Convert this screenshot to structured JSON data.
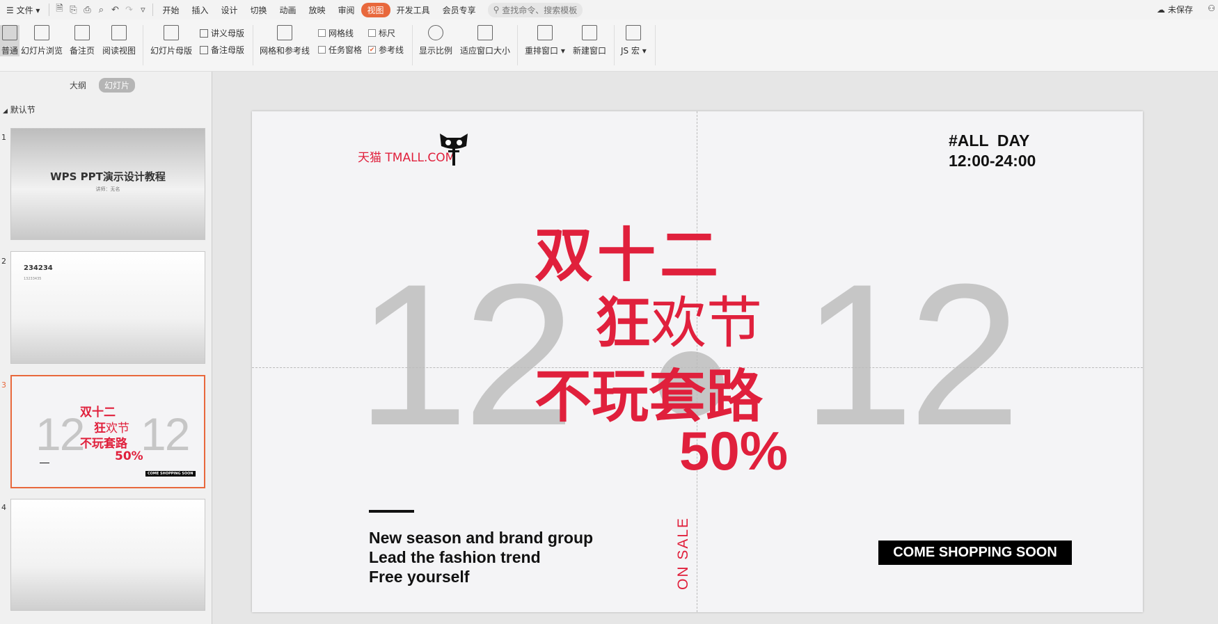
{
  "menu": {
    "file": "文件",
    "tabs": [
      "开始",
      "插入",
      "设计",
      "切换",
      "动画",
      "放映",
      "审阅",
      "视图",
      "开发工具",
      "会员专享"
    ],
    "active_tab": "视图",
    "search_placeholder": "查找命令、搜索模板",
    "save_status": "未保存"
  },
  "ribbon": {
    "normal": "普通",
    "slide_sorter": "幻灯片浏览",
    "notes_page": "备注页",
    "reading_view": "阅读视图",
    "slide_master": "幻灯片母版",
    "handout_master": "讲义母版",
    "notes_master": "备注母版",
    "grid_guides": "网格和参考线",
    "gridlines": "网格线",
    "ruler": "标尺",
    "task_pane": "任务窗格",
    "guides": "参考线",
    "zoom": "显示比例",
    "fit_window": "适应窗口大小",
    "rearrange": "重排窗口",
    "new_window": "新建窗口",
    "js_macro": "JS 宏"
  },
  "panel": {
    "tab_outline": "大纲",
    "tab_slides": "幻灯片",
    "section": "默认节",
    "thumbs": [
      {
        "num": "1",
        "title": "WPS PPT演示设计教程",
        "sub": "讲师：无名"
      },
      {
        "num": "2",
        "title": "234234",
        "sub": "13233435"
      },
      {
        "num": "3"
      },
      {
        "num": "4"
      }
    ]
  },
  "slide": {
    "logo": "天猫 TMALL.COM",
    "allday": "#ALL  DAY\n12:00-24:00",
    "big_left": "12",
    "big_right": "12",
    "line1": "双十二",
    "line2a": "狂",
    "line2b": "欢节",
    "line3": "不玩套路",
    "line4": "50%",
    "eng1": "New season and brand group",
    "eng2": "Lead the fashion trend",
    "eng3": "Free yourself",
    "onsale": "ON SALE",
    "cta": "COME SHOPPING SOON"
  },
  "colors": {
    "accent": "#e8683c",
    "brand_red": "#e0203c"
  }
}
